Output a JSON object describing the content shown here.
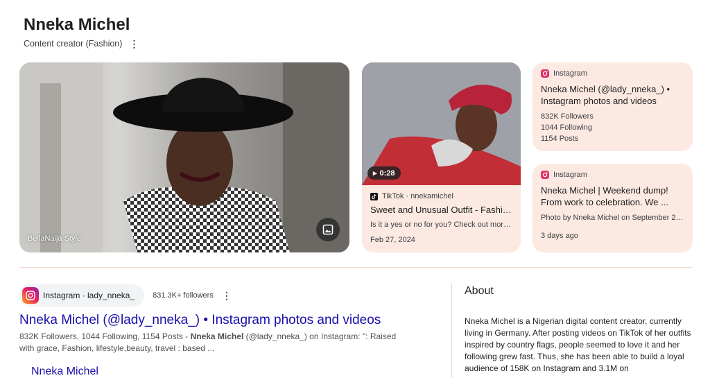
{
  "header": {
    "title": "Nneka Michel",
    "subtitle": "Content creator (Fashion)"
  },
  "hero_image": {
    "source": "BellaNaija Style"
  },
  "tiktok_card": {
    "duration": "0:28",
    "source": "TikTok · nnekamichel",
    "title": "Sweet and Unusual Outfit - Fashion...",
    "description": "Is it a yes or no for you? Check out more...",
    "date": "Feb 27, 2024"
  },
  "instagram_card_1": {
    "source": "Instagram",
    "title": "Nneka Michel (@lady_nneka_) • Instagram photos and videos",
    "followers": "832K Followers",
    "following": "1044 Following",
    "posts": "1154 Posts"
  },
  "instagram_card_2": {
    "source": "Instagram",
    "title": "Nneka Michel | Weekend dump! From work to celebration. We ...",
    "description": "Photo by Nneka Michel on September 27,...",
    "date": "3 days ago"
  },
  "result": {
    "chip_label": "Instagram · lady_nneka_",
    "followers": "831.3K+ followers",
    "title": "Nneka Michel (@lady_nneka_) • Instagram photos and videos",
    "snippet_pre": "832K Followers, 1044 Following, 1154 Posts - ",
    "snippet_bold": "Nneka Michel",
    "snippet_post": " (@lady_nneka_) on Instagram: \": Raised with grace, Fashion, lifestyle,beauty, travel : based ...",
    "sublink": "Nneka Michel"
  },
  "about": {
    "heading": "About",
    "text": "Nneka Michel is a Nigerian digital content creator, currently living in Germany. After posting videos on TikTok of her outfits inspired by country flags, people seemed to love it and her following grew fast. Thus, she has been able to build a loyal audience of 158K on Instagram and 3.1M on"
  },
  "colors": {
    "card_bg": "#fce9e2",
    "link": "#1a0dab"
  }
}
